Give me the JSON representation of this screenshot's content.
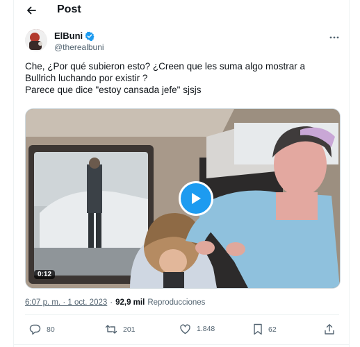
{
  "header": {
    "title": "Post"
  },
  "author": {
    "name": "ElBuni",
    "handle": "@therealbuni"
  },
  "tweet": {
    "lines": [
      "Che, ¿Por qué subieron esto? ¿Creen que les suma algo mostrar a Bullrich luchando por existir ?",
      "Parece que dice \"estoy cansada jefe\" sjsjs"
    ]
  },
  "media": {
    "duration": "0:12"
  },
  "meta": {
    "time": "6:07 p. m. · 1 oct. 2023",
    "separator": "·",
    "views_count": "92,9 mil",
    "views_label": "Reproducciones"
  },
  "actions": {
    "replies": "80",
    "reposts": "201",
    "likes": "1.848",
    "bookmarks": "62"
  },
  "colors": {
    "accent": "#1d9bf0",
    "secondary_text": "#536471",
    "primary_text": "#0f1419",
    "border": "#eff3f4"
  },
  "icons": [
    "back-arrow-icon",
    "verified-badge-icon",
    "more-icon",
    "play-icon",
    "reply-icon",
    "repost-icon",
    "like-icon",
    "bookmark-icon",
    "share-icon"
  ]
}
